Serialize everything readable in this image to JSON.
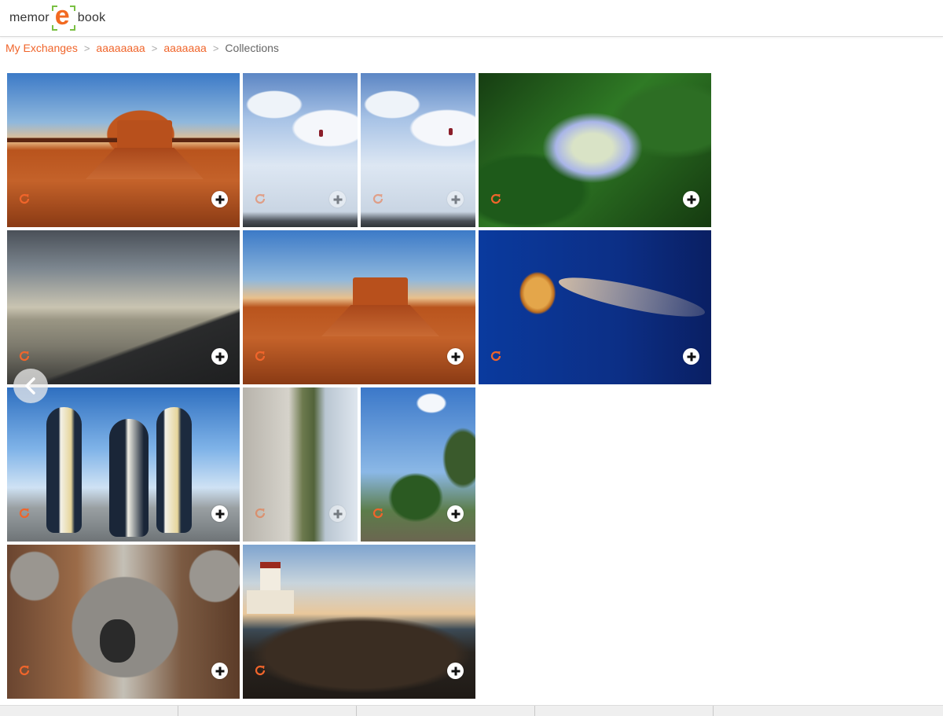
{
  "header": {
    "logo": {
      "text_before": "memor",
      "letter": "e",
      "text_after": "book"
    }
  },
  "breadcrumb": {
    "items": [
      "My Exchanges",
      "aaaaaaaa",
      "aaaaaaa"
    ],
    "separator": ">",
    "current": "Collections"
  },
  "colors": {
    "accent": "#f0652b",
    "logo_green": "#7ac043"
  },
  "gallery": {
    "photos": [
      {
        "subject": "desert butte at sunset",
        "state": "active"
      },
      {
        "subject": "paraglider in cloudy sky",
        "state": "faded"
      },
      {
        "subject": "paraglider in cloudy sky",
        "state": "faded"
      },
      {
        "subject": "blue hydrangea flowers",
        "state": "active"
      },
      {
        "subject": "cloudy lakeside at dusk",
        "state": "active"
      },
      {
        "subject": "desert butte at sunset",
        "state": "active"
      },
      {
        "subject": "jellyfish in deep blue",
        "state": "active"
      },
      {
        "subject": "emperor penguins",
        "state": "active"
      },
      {
        "subject": "rotated lakeside landscape",
        "state": "faded"
      },
      {
        "subject": "palm trees and blue sky",
        "state": "active"
      },
      {
        "subject": "koala",
        "state": "active"
      },
      {
        "subject": "lighthouse on rocky coast",
        "state": "active"
      }
    ],
    "icons": {
      "rotate": "rotate-icon",
      "add": "plus-circle-icon",
      "prev": "chevron-left-icon"
    }
  }
}
